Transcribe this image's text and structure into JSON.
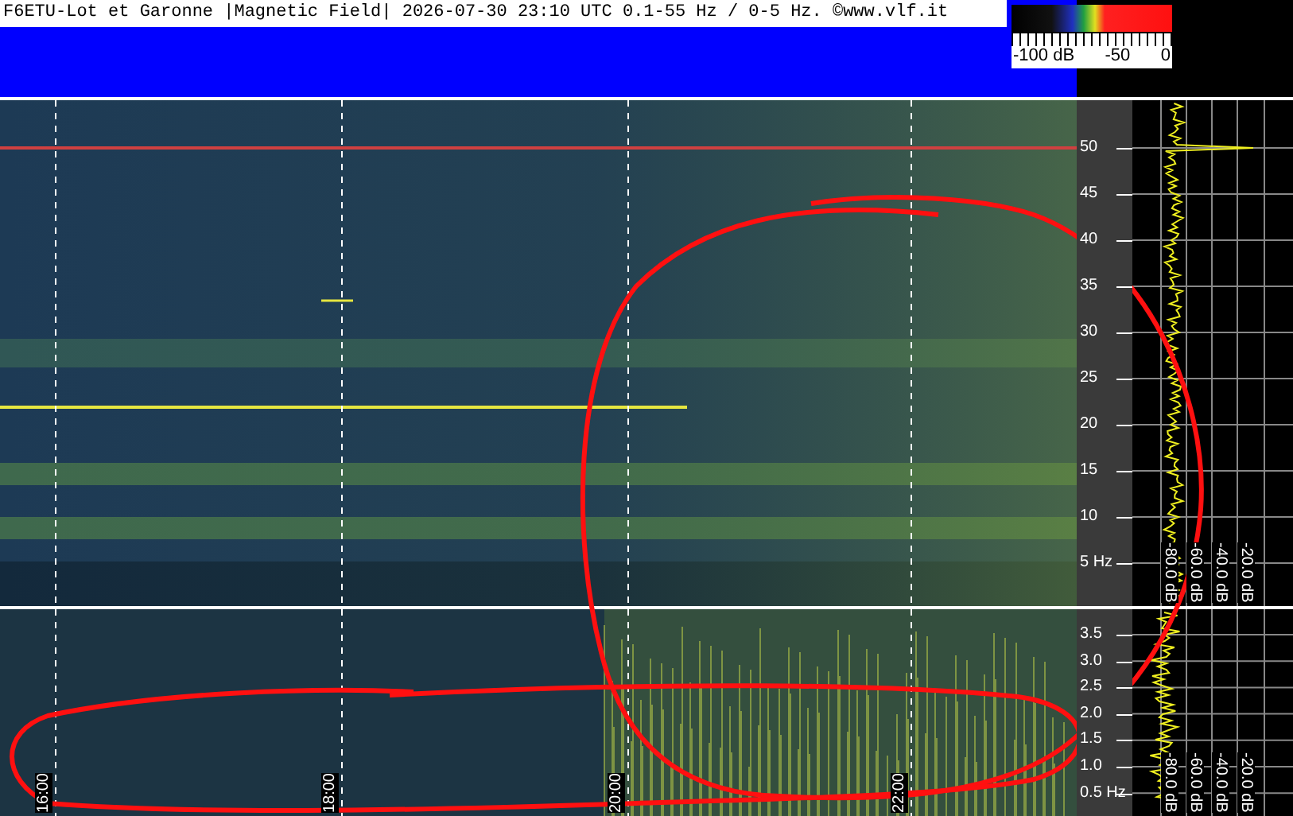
{
  "title": "F6ETU-Lot et Garonne |Magnetic Field| 2026-07-30 23:10 UTC 0.1-55 Hz / 0-5 Hz. ©www.vlf.it",
  "legend": {
    "labels": [
      "-100 dB",
      "-50",
      "0"
    ]
  },
  "upper_panel": {
    "freq_ticks": [
      "50",
      "45",
      "40",
      "35",
      "30",
      "25",
      "20",
      "15",
      "10",
      "5 Hz"
    ],
    "db_labels": [
      "-80.0 dB",
      "-60.0 dB",
      "-40.0 dB",
      "-20.0 dB"
    ]
  },
  "lower_panel": {
    "freq_ticks": [
      "3.5",
      "3.0",
      "2.5",
      "2.0",
      "1.5",
      "1.0",
      "0.5 Hz"
    ],
    "db_labels": [
      "-80.0 dB",
      "-60.0 dB",
      "-40.0 dB",
      "-20.0 dB"
    ]
  },
  "time_labels": [
    "16:00",
    "18:00",
    "20:00",
    "22:00"
  ]
}
